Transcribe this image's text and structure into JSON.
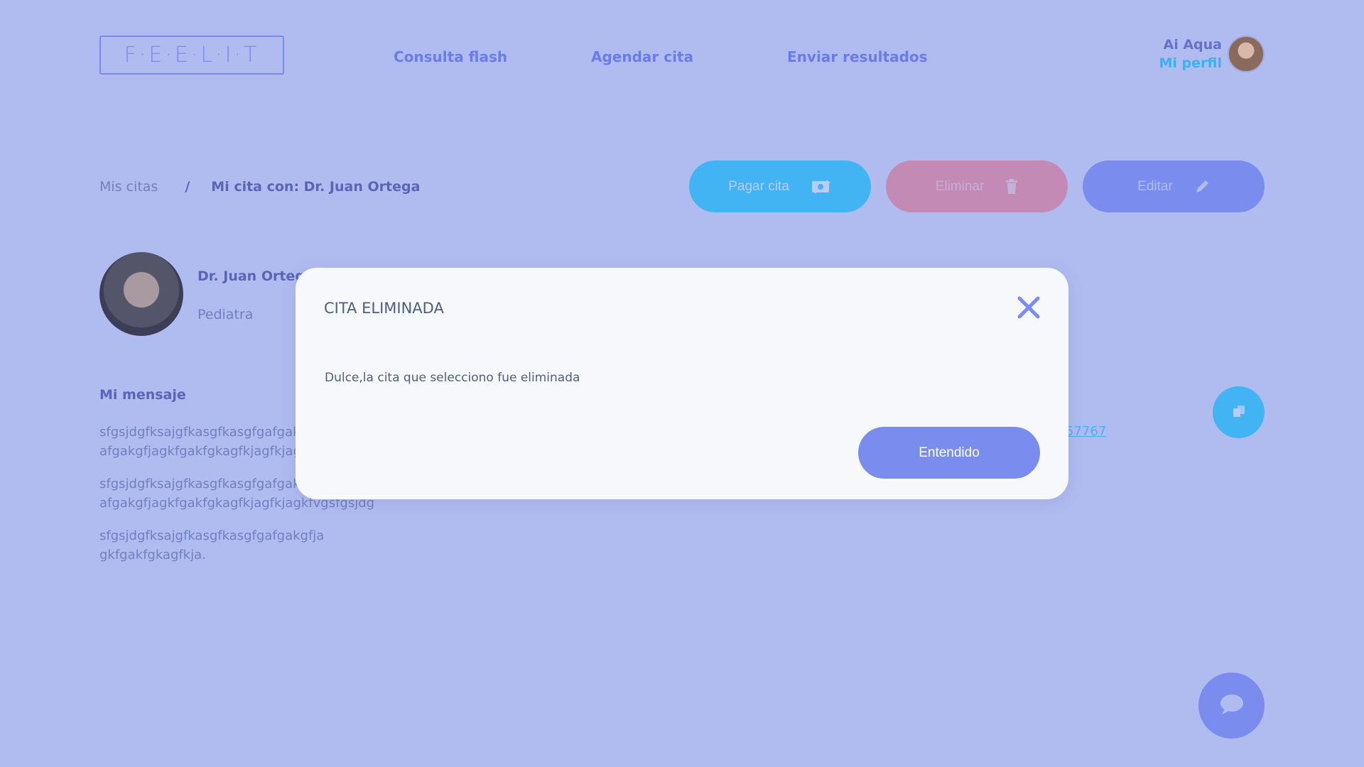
{
  "header": {
    "logo": "F·E·E·L·I·T",
    "nav": [
      "Consulta flash",
      "Agendar cita",
      "Enviar resultados"
    ],
    "user_name": "Ai Aqua",
    "profile_link": "Mi perfil"
  },
  "breadcrumb": {
    "parent": "Mis citas",
    "separator": "/",
    "current": "Mi cita con: Dr. Juan Ortega"
  },
  "actions": {
    "pay_label": "Pagar cita",
    "delete_label": "Eliminar",
    "edit_label": "Editar"
  },
  "doctor": {
    "name": "Dr. Juan Ortega",
    "specialty": "Pediatra"
  },
  "message": {
    "title": "Mi mensaje",
    "paragraphs": [
      "sfgsjdgfksajgfkasgfkasgfgafgak\nafgakgfjagkfgakfgkagfkjagfkjag",
      "sfgsjdgfksajgfkasgfkasgfgafgak\nafgakgfjagkfgakfgkagfkjagfkjagkfvgsfgsjdg",
      "sfgsjdgfksajgfkasgfkasgfgafgakgfja\ngkfgakfgkagfkja."
    ],
    "side_link": "57767"
  },
  "modal": {
    "title": "CITA ELIMINADA",
    "body": "Dulce,la cita que selecciono fue eliminada",
    "confirm_label": "Entendido"
  },
  "colors": {
    "overlay_bg": "#b0bcf0",
    "primary": "#7b8cef",
    "accent_blue": "#43b4f3",
    "danger": "#c48ab6",
    "modal_bg": "#f6f8fb"
  },
  "icons": {
    "pay": "money-exchange-icon",
    "delete": "trash-icon",
    "edit": "pencil-icon",
    "close": "close-icon",
    "copy": "copy-icon",
    "chat": "chat-bubble-icon"
  }
}
